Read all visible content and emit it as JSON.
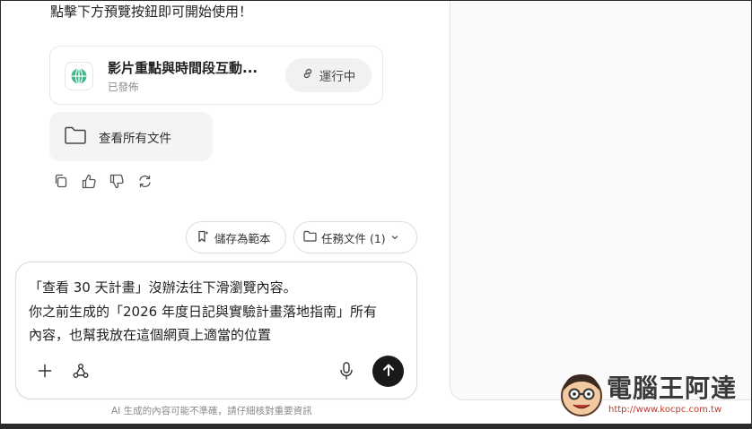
{
  "message": {
    "intro_text": "點擊下方預覽按鈕即可開始使用！",
    "artifact": {
      "title": "影片重點與時間段互動...",
      "status": "已發佈",
      "running_label": "運行中"
    },
    "files_card_label": "查看所有文件"
  },
  "actions": {
    "save_template_label": "儲存為範本",
    "task_files_label": "任務文件 (1)"
  },
  "composer": {
    "lines": [
      "「查看 30 天計畫」沒辦法往下滑瀏覽內容。",
      "你之前生成的「2026 年度日記與實驗計畫落地指南」所有",
      "內容，也幫我放在這個網頁上適當的位置"
    ]
  },
  "disclaimer": "AI 生成的內容可能不準確，請仔細核對重要資訊",
  "watermark": {
    "name": "電腦王阿達",
    "url": "http://www.kocpc.com.tw"
  },
  "icons": {
    "artifact": "globe-icon",
    "running": "link-icon",
    "files": "folder-icon",
    "copy": "copy-icon",
    "like": "thumbs-up-icon",
    "dislike": "thumbs-down-icon",
    "regenerate": "refresh-icon",
    "save_template": "sparkle-bookmark-icon",
    "task_files": "folder-icon",
    "dropdown": "chevron-down-icon",
    "add": "plus-icon",
    "tools": "nodes-icon",
    "mic": "microphone-icon",
    "send": "arrow-up-icon"
  },
  "colors": {
    "accent_globe": "#2fa37a",
    "send_button": "#1a1a1a",
    "watermark_url": "#c0392b"
  }
}
